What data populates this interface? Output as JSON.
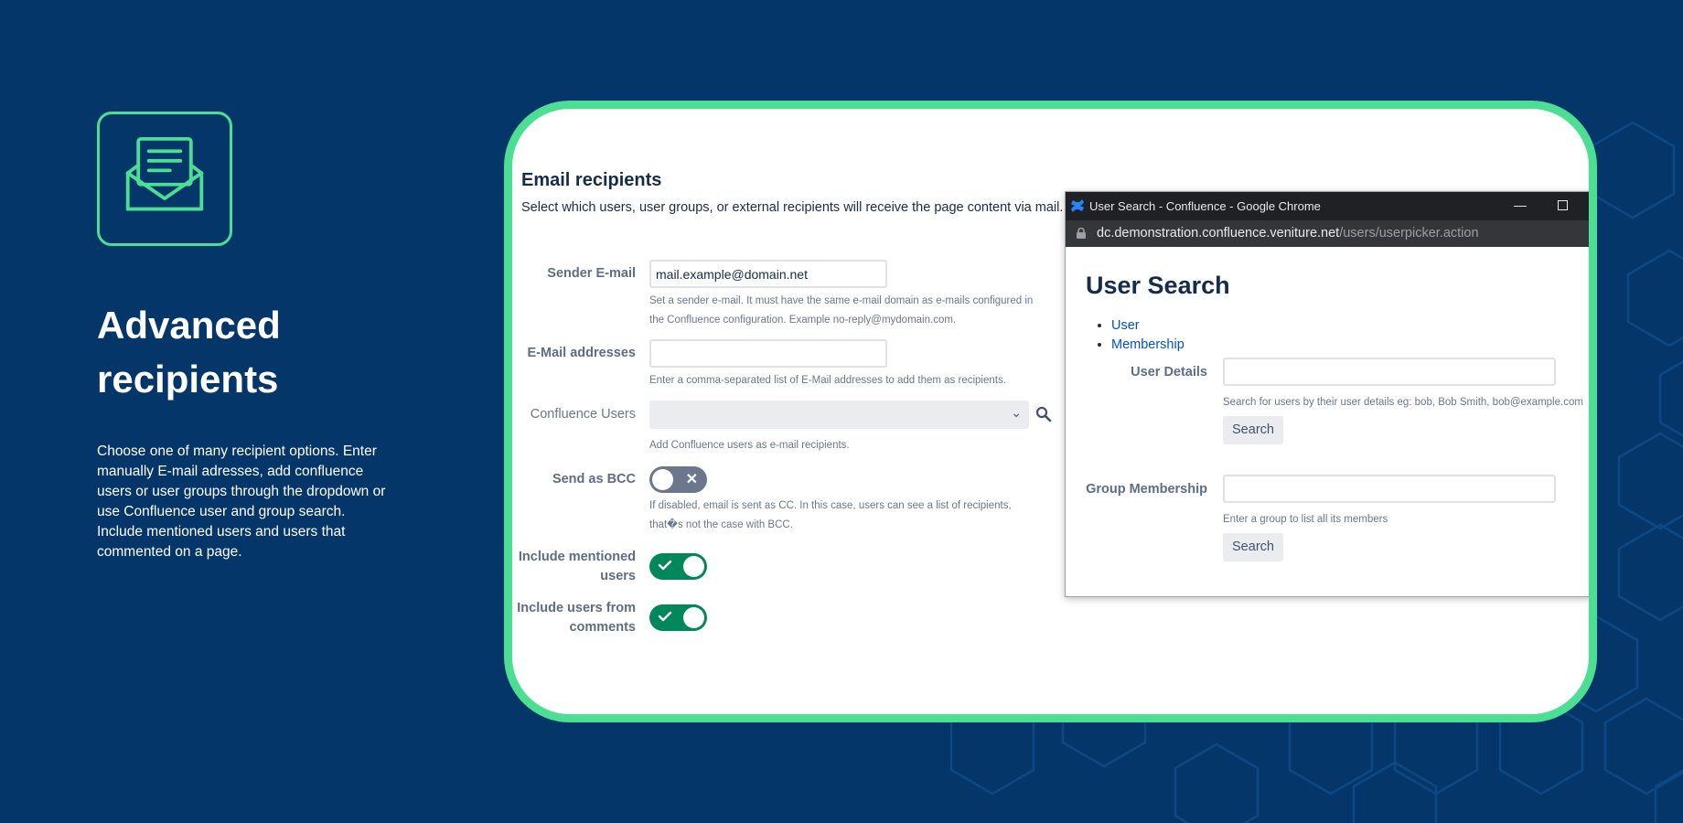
{
  "hero": {
    "icon": "open-envelope-icon",
    "title": "Advanced recipients",
    "description": "Choose one of many recipient options. Enter manually E-mail adresses, add confluence users or user groups through the dropdown or use Confluence user and group search. Include mentioned users and users that commented on a page."
  },
  "colors": {
    "background": "#05366a",
    "accent": "#4cdf93",
    "toggle_on": "#00875a",
    "toggle_off": "#6b778c"
  },
  "form": {
    "heading": "Email recipients",
    "description": "Select which users, user groups, or external recipients will receive the page content via mail.",
    "sender": {
      "label": "Sender E-mail",
      "value": "mail.example@domain.net",
      "help1": "Set a sender e-mail. It must have the same e-mail domain as e-mails configured in",
      "help2": "the Confluence configuration. Example no-reply@mydomain.com."
    },
    "emails": {
      "label": "E-Mail addresses",
      "value": "",
      "help": "Enter a comma-separated list of E-Mail addresses to add them as recipients."
    },
    "confluence_users": {
      "label": "Confluence Users",
      "help": "Add Confluence users as e-mail recipients."
    },
    "bcc": {
      "label": "Send as BCC",
      "state": "off",
      "help1": "If disabled, email is sent as CC. In this case, users can see a list of recipients,",
      "help2": "that�s not the case with BCC."
    },
    "mentioned": {
      "label1": "Include mentioned",
      "label2": "users",
      "state": "on"
    },
    "comments": {
      "label1": "Include users from",
      "label2": "comments",
      "state": "on"
    }
  },
  "popup": {
    "window_title": "User Search - Confluence - Google Chrome",
    "url_host": "dc.demonstration.confluence.veniture.net",
    "url_path": "/users/userpicker.action",
    "title": "User Search",
    "links": [
      "User",
      "Membership"
    ],
    "user_details": {
      "label": "User Details",
      "help": "Search for users by their user details eg: bob, Bob Smith, bob@example.com",
      "button": "Search"
    },
    "group": {
      "label": "Group Membership",
      "help": "Enter a group to list all its members",
      "button": "Search"
    }
  }
}
